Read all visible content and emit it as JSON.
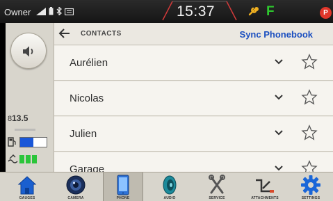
{
  "status_bar": {
    "profile": "Owner",
    "time": "15:37",
    "gear": "F",
    "alert": "P"
  },
  "left_panel": {
    "voltage": "13.5",
    "fuel_level": 0.5,
    "def_level_bars": 3
  },
  "header": {
    "title": "CONTACTS",
    "sync_label": "Sync Phonebook"
  },
  "contacts": [
    {
      "name": "Aurélien"
    },
    {
      "name": "Nicolas"
    },
    {
      "name": "Julien"
    },
    {
      "name": "Garage"
    }
  ],
  "nav": [
    {
      "label": "GAUGES",
      "icon": "house-icon"
    },
    {
      "label": "CAMERA",
      "icon": "camera-icon"
    },
    {
      "label": "PHONE",
      "icon": "phone-icon"
    },
    {
      "label": "AUDIO",
      "icon": "speaker-icon"
    },
    {
      "label": "SERVICE",
      "icon": "wrench-icon"
    },
    {
      "label": "ATTACHMENTS",
      "icon": "attachment-icon"
    },
    {
      "label": "SETTINGS",
      "icon": "settings-gear-icon"
    }
  ],
  "active_nav": "PHONE",
  "colors": {
    "accent_blue": "#1a4fc0",
    "fuel_blue": "#1a57d8",
    "def_green": "#2bc53a",
    "gear_green": "#2ec82e",
    "alert_red": "#e0362a",
    "clock_frame_red": "#d23a3a"
  }
}
